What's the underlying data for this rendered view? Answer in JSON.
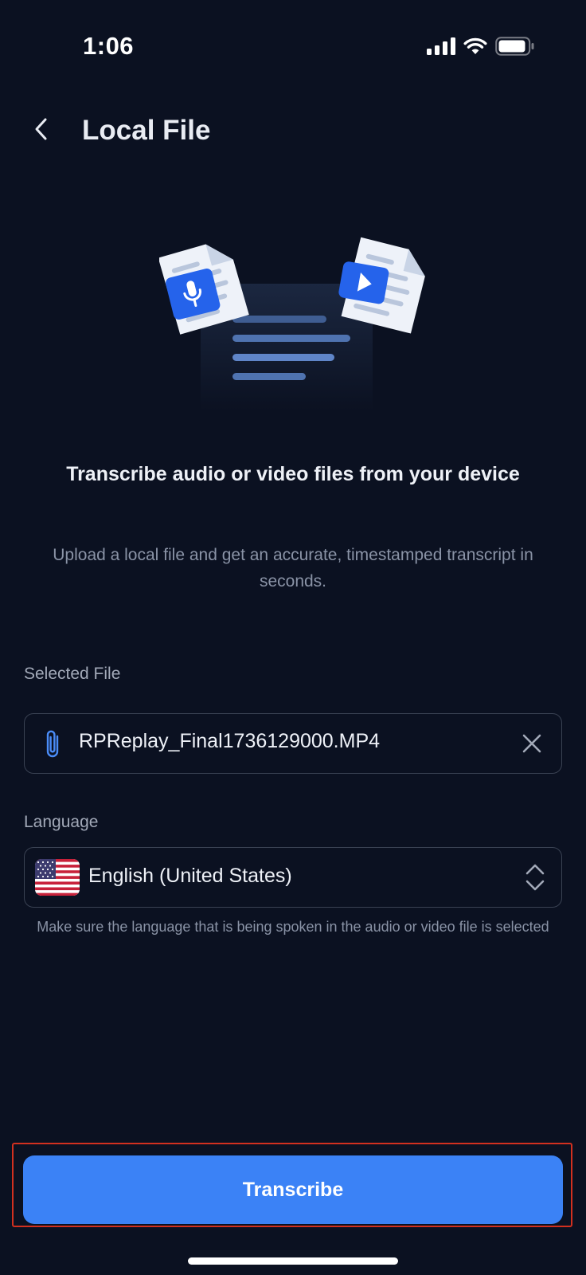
{
  "status_bar": {
    "time": "1:06",
    "icons": [
      "cellular-signal-icon",
      "wifi-icon",
      "battery-icon"
    ]
  },
  "header": {
    "back_icon": "chevron-left-icon",
    "title": "Local File"
  },
  "illustration": {
    "icons": [
      "microphone-icon",
      "play-icon",
      "document-icon"
    ]
  },
  "intro": {
    "headline": "Transcribe audio or video files from your device",
    "description": "Upload a local file and get an accurate, timestamped transcript in seconds."
  },
  "selected_file": {
    "label": "Selected File",
    "file_name": "RPReplay_Final1736129000.MP4",
    "icons": [
      "paperclip-icon",
      "close-icon"
    ]
  },
  "language": {
    "label": "Language",
    "selected": "English (United States)",
    "icons": [
      "us-flag-icon",
      "chevron-up-down-icon"
    ],
    "hint": "Make sure the language that is being spoken in the audio or video file is selected"
  },
  "actions": {
    "transcribe_label": "Transcribe"
  },
  "colors": {
    "background": "#0b1121",
    "accent": "#3b82f6",
    "highlight_outline": "#d2301f"
  }
}
